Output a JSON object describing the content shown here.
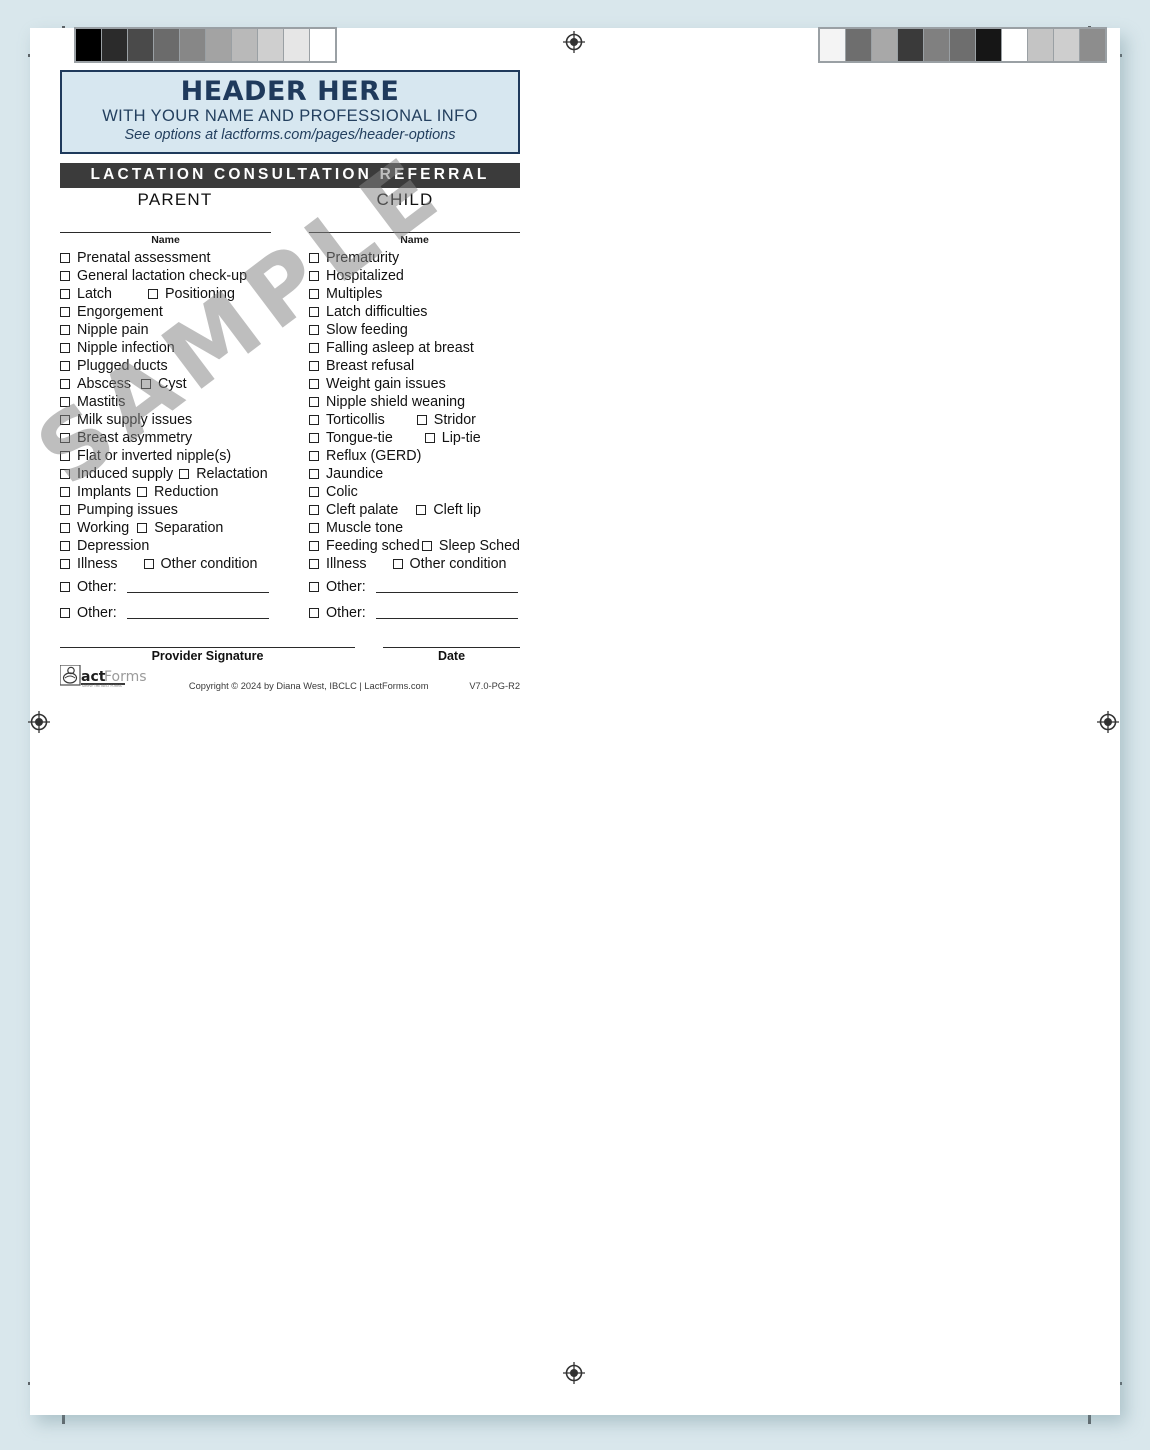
{
  "page": {
    "background_color": "#d9e7ec",
    "sheet_color": "#ffffff",
    "watermark": "SAMPLE"
  },
  "calibration": {
    "left_strip": [
      "#000000",
      "#2b2b2b",
      "#4a4a4a",
      "#6b6b6b",
      "#878787",
      "#a3a3a3",
      "#b9b9b9",
      "#cfcfcf",
      "#e6e6e6",
      "#ffffff"
    ],
    "right_strip": [
      "#f4f4f4",
      "#6e6e6e",
      "#a8a8a8",
      "#3a3a3a",
      "#808080",
      "#6e6e6e",
      "#161616",
      "#ffffff",
      "#c4c4c4",
      "#cecece",
      "#8d8d8d"
    ]
  },
  "header": {
    "title": "HEADER HERE",
    "subtitle": "WITH YOUR NAME AND PROFESSIONAL INFO",
    "note": "See options at lactforms.com/pages/header-options",
    "border_color": "#1f3a5c",
    "fill_color": "#d7e7f0"
  },
  "title_bar": {
    "label": "LACTATION CONSULTATION REFERRAL",
    "background_color": "#3b3b3b",
    "text_color": "#ffffff"
  },
  "column_headings": [
    "PARENT",
    "CHILD"
  ],
  "name_label": "Name",
  "parent_items": [
    {
      "items": [
        {
          "label": "Prenatal assessment"
        }
      ]
    },
    {
      "items": [
        {
          "label": "General lactation check-up"
        }
      ]
    },
    {
      "items": [
        {
          "label": "Latch"
        },
        {
          "label": "Positioning",
          "indent": 36
        }
      ]
    },
    {
      "items": [
        {
          "label": "Engorgement"
        }
      ]
    },
    {
      "items": [
        {
          "label": "Nipple pain"
        }
      ]
    },
    {
      "items": [
        {
          "label": "Nipple infection"
        }
      ]
    },
    {
      "items": [
        {
          "label": "Plugged ducts"
        }
      ]
    },
    {
      "items": [
        {
          "label": "Abscess"
        },
        {
          "label": "Cyst",
          "indent": 10
        }
      ]
    },
    {
      "items": [
        {
          "label": "Mastitis"
        }
      ]
    },
    {
      "items": [
        {
          "label": "Milk supply issues"
        }
      ]
    },
    {
      "items": [
        {
          "label": "Breast asymmetry"
        }
      ]
    },
    {
      "items": [
        {
          "label": "Flat or inverted nipple(s)"
        }
      ]
    },
    {
      "items": [
        {
          "label": "Induced supply"
        },
        {
          "label": "Relactation",
          "indent": 6
        }
      ]
    },
    {
      "items": [
        {
          "label": "Implants"
        },
        {
          "label": "Reduction",
          "indent": 6
        }
      ]
    },
    {
      "items": [
        {
          "label": "Pumping issues"
        }
      ]
    },
    {
      "items": [
        {
          "label": "Working"
        },
        {
          "label": "Separation",
          "indent": 8
        }
      ]
    },
    {
      "items": [
        {
          "label": "Depression"
        }
      ]
    },
    {
      "items": [
        {
          "label": "Illness"
        },
        {
          "label": "Other condition",
          "indent": 26
        }
      ]
    }
  ],
  "child_items": [
    {
      "items": [
        {
          "label": "Prematurity"
        }
      ]
    },
    {
      "items": [
        {
          "label": "Hospitalized"
        }
      ]
    },
    {
      "items": [
        {
          "label": "Multiples"
        }
      ]
    },
    {
      "items": [
        {
          "label": "Latch difficulties"
        }
      ]
    },
    {
      "items": [
        {
          "label": "Slow feeding"
        }
      ]
    },
    {
      "items": [
        {
          "label": "Falling asleep at breast"
        }
      ]
    },
    {
      "items": [
        {
          "label": "Breast refusal"
        }
      ]
    },
    {
      "items": [
        {
          "label": "Weight gain issues"
        }
      ]
    },
    {
      "items": [
        {
          "label": "Nipple shield weaning"
        }
      ]
    },
    {
      "items": [
        {
          "label": "Torticollis"
        },
        {
          "label": "Stridor",
          "indent": 32
        }
      ]
    },
    {
      "items": [
        {
          "label": "Tongue-tie"
        },
        {
          "label": "Lip-tie",
          "indent": 32
        }
      ]
    },
    {
      "items": [
        {
          "label": "Reflux (GERD)"
        }
      ]
    },
    {
      "items": [
        {
          "label": "Jaundice"
        }
      ]
    },
    {
      "items": [
        {
          "label": "Colic"
        }
      ]
    },
    {
      "items": [
        {
          "label": "Cleft palate"
        },
        {
          "label": "Cleft lip",
          "indent": 18
        }
      ]
    },
    {
      "items": [
        {
          "label": "Muscle tone"
        }
      ]
    },
    {
      "items": [
        {
          "label": "Feeding sched"
        },
        {
          "label": "Sleep Sched",
          "indent": 4
        }
      ]
    },
    {
      "items": [
        {
          "label": "Illness"
        },
        {
          "label": "Other condition",
          "indent": 26
        }
      ]
    }
  ],
  "other_rows": {
    "label": "Other:",
    "count": 2
  },
  "footer": {
    "signature_caption": "Provider Signature",
    "date_caption": "Date",
    "logo_text": "actForms",
    "copyright": "Copyright © 2024 by Diana West, IBCLC  |  LactForms.com",
    "version": "V7.0-PG-R2"
  }
}
